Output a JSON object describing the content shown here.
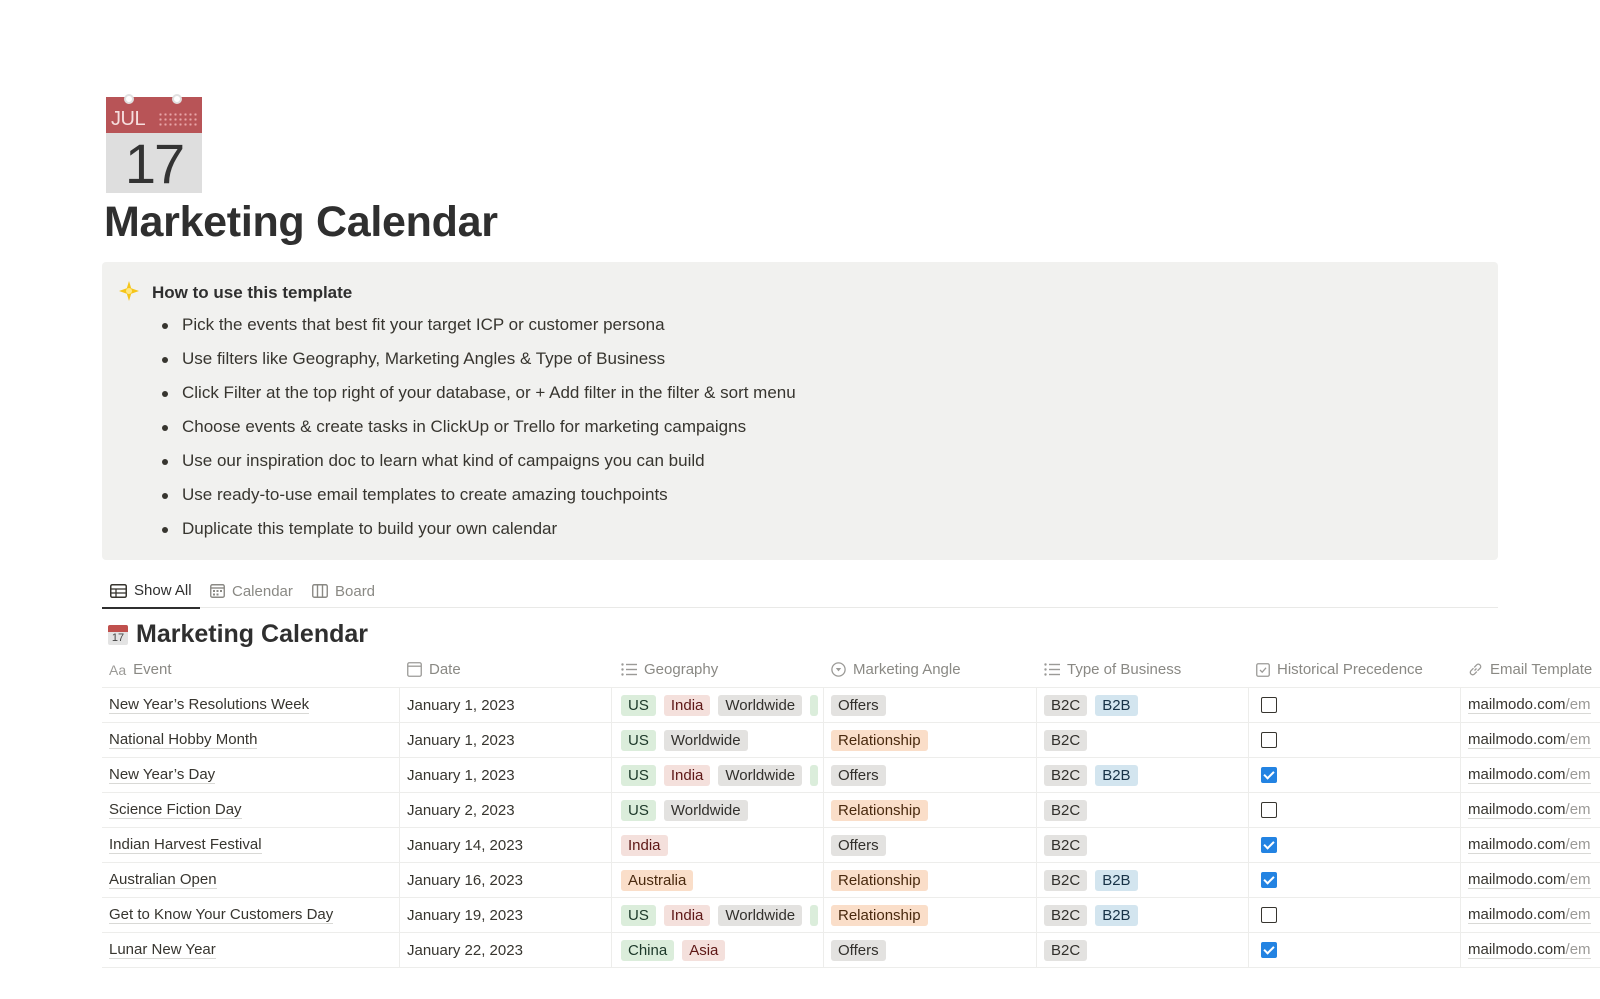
{
  "page": {
    "icon": {
      "name": "calendar-icon",
      "month": "JUL",
      "day": "17"
    },
    "title": "Marketing Calendar"
  },
  "callout": {
    "icon": "sparkle-star",
    "title": "How to use this template",
    "items": [
      "Pick the events that best fit your target ICP or customer persona",
      "Use filters like Geography, Marketing Angles & Type of Business",
      "Click Filter at the top right of your database, or + Add filter in the filter & sort menu",
      "Choose events & create tasks in ClickUp or Trello for marketing campaigns",
      "Use our inspiration doc to learn what kind of campaigns you can build",
      "Use ready-to-use email templates to create amazing touchpoints",
      "Duplicate this template to build your own calendar"
    ]
  },
  "views": {
    "tabs": [
      {
        "label": "Show All",
        "icon": "table-icon",
        "active": true
      },
      {
        "label": "Calendar",
        "icon": "calendar-view-icon",
        "active": false
      },
      {
        "label": "Board",
        "icon": "board-icon",
        "active": false
      }
    ]
  },
  "database": {
    "title": "Marketing Calendar",
    "icon_day": "17",
    "columns": [
      {
        "label": "Event",
        "icon": "text-property-icon",
        "glyph": "Aa"
      },
      {
        "label": "Date",
        "icon": "date-property-icon"
      },
      {
        "label": "Geography",
        "icon": "multi-select-icon"
      },
      {
        "label": "Marketing Angle",
        "icon": "select-icon"
      },
      {
        "label": "Type of Business",
        "icon": "multi-select-icon"
      },
      {
        "label": "Historical Precedence",
        "icon": "checkbox-property-icon"
      },
      {
        "label": "Email Template",
        "icon": "link-icon"
      }
    ],
    "tag_colors": {
      "US": "green",
      "India": "red",
      "Worldwide": "gray",
      "Australia": "orange",
      "China": "green",
      "Asia": "red",
      "Offers": "gray",
      "Relationship": "orange",
      "B2C": "gray",
      "B2B": "blue"
    },
    "rows": [
      {
        "event": "New Year’s Resolutions Week",
        "date": "January 1, 2023",
        "geography": [
          "US",
          "India",
          "Worldwide"
        ],
        "geography_more": true,
        "angle": "Offers",
        "type": [
          "B2C",
          "B2B"
        ],
        "historical": false,
        "email_domain": "mailmodo.com",
        "email_path": "/em"
      },
      {
        "event": "National Hobby Month",
        "date": "January 1, 2023",
        "geography": [
          "US",
          "Worldwide"
        ],
        "geography_more": false,
        "angle": "Relationship",
        "type": [
          "B2C"
        ],
        "historical": false,
        "email_domain": "mailmodo.com",
        "email_path": "/em"
      },
      {
        "event": "New Year’s Day",
        "date": "January 1, 2023",
        "geography": [
          "US",
          "India",
          "Worldwide"
        ],
        "geography_more": true,
        "angle": "Offers",
        "type": [
          "B2C",
          "B2B"
        ],
        "historical": true,
        "email_domain": "mailmodo.com",
        "email_path": "/em"
      },
      {
        "event": "Science Fiction Day",
        "date": "January 2, 2023",
        "geography": [
          "US",
          "Worldwide"
        ],
        "geography_more": false,
        "angle": "Relationship",
        "type": [
          "B2C"
        ],
        "historical": false,
        "email_domain": "mailmodo.com",
        "email_path": "/em"
      },
      {
        "event": "Indian Harvest Festival",
        "date": "January 14, 2023",
        "geography": [
          "India"
        ],
        "geography_more": false,
        "angle": "Offers",
        "type": [
          "B2C"
        ],
        "historical": true,
        "email_domain": "mailmodo.com",
        "email_path": "/em"
      },
      {
        "event": "Australian Open",
        "date": "January 16, 2023",
        "geography": [
          "Australia"
        ],
        "geography_more": false,
        "angle": "Relationship",
        "type": [
          "B2C",
          "B2B"
        ],
        "historical": true,
        "email_domain": "mailmodo.com",
        "email_path": "/em"
      },
      {
        "event": "Get to Know Your Customers Day",
        "date": "January 19, 2023",
        "geography": [
          "US",
          "India",
          "Worldwide"
        ],
        "geography_more": true,
        "angle": "Relationship",
        "type": [
          "B2C",
          "B2B"
        ],
        "historical": false,
        "email_domain": "mailmodo.com",
        "email_path": "/em"
      },
      {
        "event": "Lunar New Year",
        "date": "January 22, 2023",
        "geography": [
          "China",
          "Asia"
        ],
        "geography_more": false,
        "angle": "Offers",
        "type": [
          "B2C"
        ],
        "historical": true,
        "email_domain": "mailmodo.com",
        "email_path": "/em"
      }
    ]
  },
  "colors": {
    "checkbox_checked": "#2383e2",
    "callout_bg": "#f1f1ef",
    "calendar_red": "#b85457"
  }
}
